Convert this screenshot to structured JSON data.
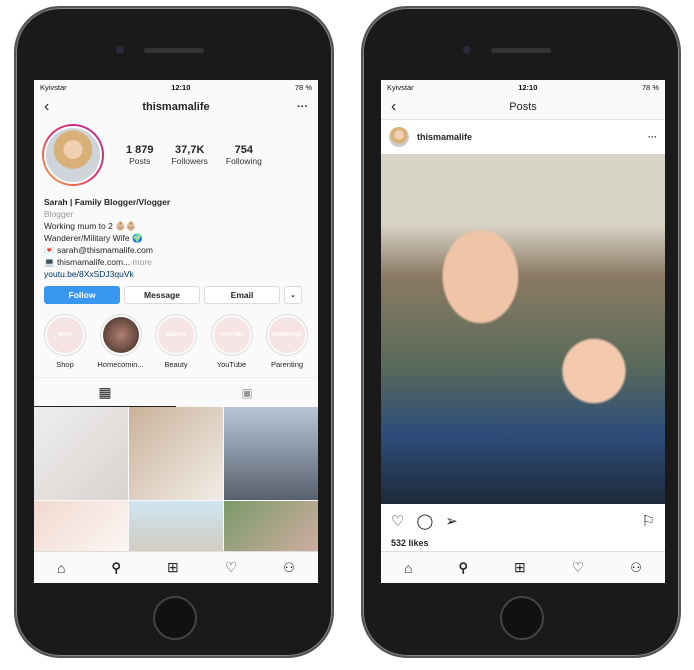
{
  "status": {
    "carrier": "Kyivstar",
    "time": "12:10",
    "battery": "78 %"
  },
  "profile": {
    "username": "thismamalife",
    "stats": [
      {
        "value": "1 879",
        "label": "Posts"
      },
      {
        "value": "37,7K",
        "label": "Followers"
      },
      {
        "value": "754",
        "label": "Following"
      }
    ],
    "bio": {
      "name": "Sarah | Family Blogger/Vlogger",
      "category": "Blogger",
      "line1": "Working mum to 2 👶🏼👶🏼",
      "line2": "Wanderer/Military Wife 🌍",
      "email": "💌 sarah@thismamalife.com",
      "site": "💻 thismamalife.com...",
      "more": "more",
      "link": "youtu.be/8XxSDJ3quVk"
    },
    "buttons": {
      "follow": "Follow",
      "message": "Message",
      "email": "Email"
    },
    "highlights": [
      {
        "label": "Shop",
        "tag": "SHOP"
      },
      {
        "label": "Homecomin...",
        "tag": ""
      },
      {
        "label": "Beauty",
        "tag": "BEAUTY"
      },
      {
        "label": "YouTube",
        "tag": "YOUTUBE"
      },
      {
        "label": "Parenting",
        "tag": "PARENTING"
      }
    ]
  },
  "post": {
    "title": "Posts",
    "username": "thismamalife",
    "likes": "532 likes"
  },
  "colors": {
    "accent": "#3897f0",
    "link": "#003569"
  }
}
